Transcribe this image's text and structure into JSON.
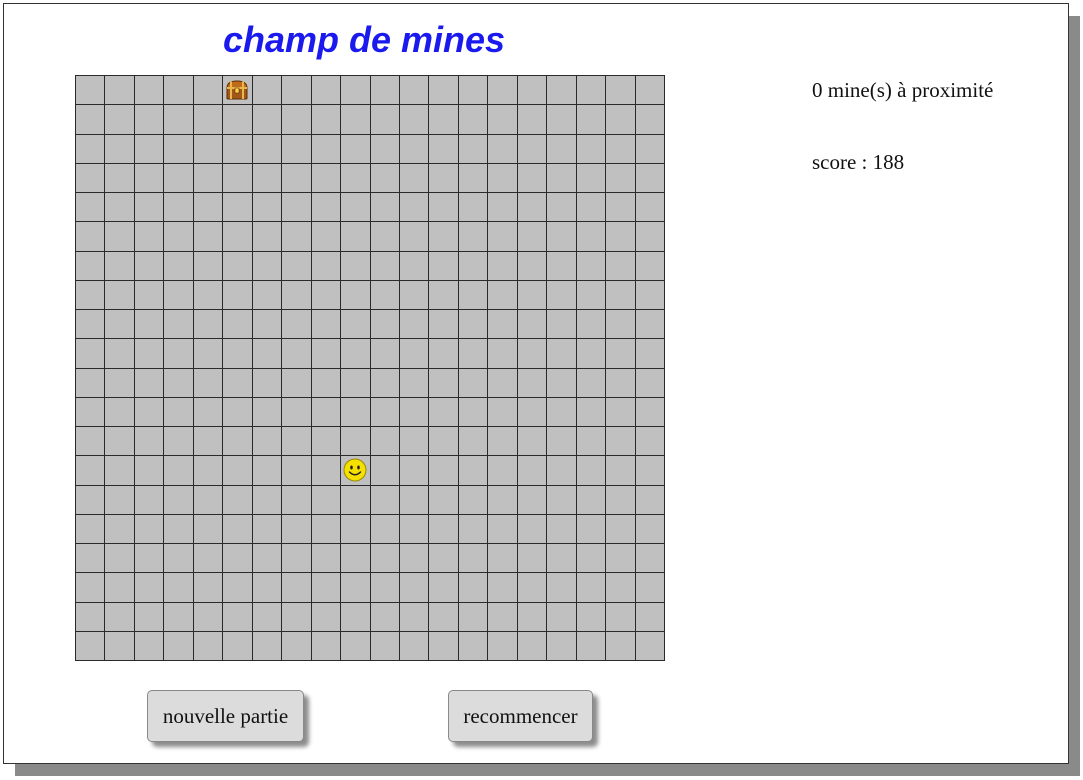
{
  "game": {
    "title": "champ de mines",
    "grid": {
      "columns": 20,
      "rows": 20,
      "cell_color": "#c0c0c0",
      "line_color": "#2a2a2a",
      "items": [
        {
          "type": "treasure-chest",
          "column": 6,
          "row": 1
        },
        {
          "type": "player-smiley",
          "column": 10,
          "row": 14
        }
      ]
    }
  },
  "status": {
    "proximity_text": "0 mine(s) à proximité",
    "score_text": "score : 188"
  },
  "controls": {
    "new_game_label": "nouvelle partie",
    "restart_label": "recommencer"
  },
  "colors": {
    "title": "#1a1aee",
    "smiley": "#f5e100",
    "chest": "#c06a1c"
  }
}
